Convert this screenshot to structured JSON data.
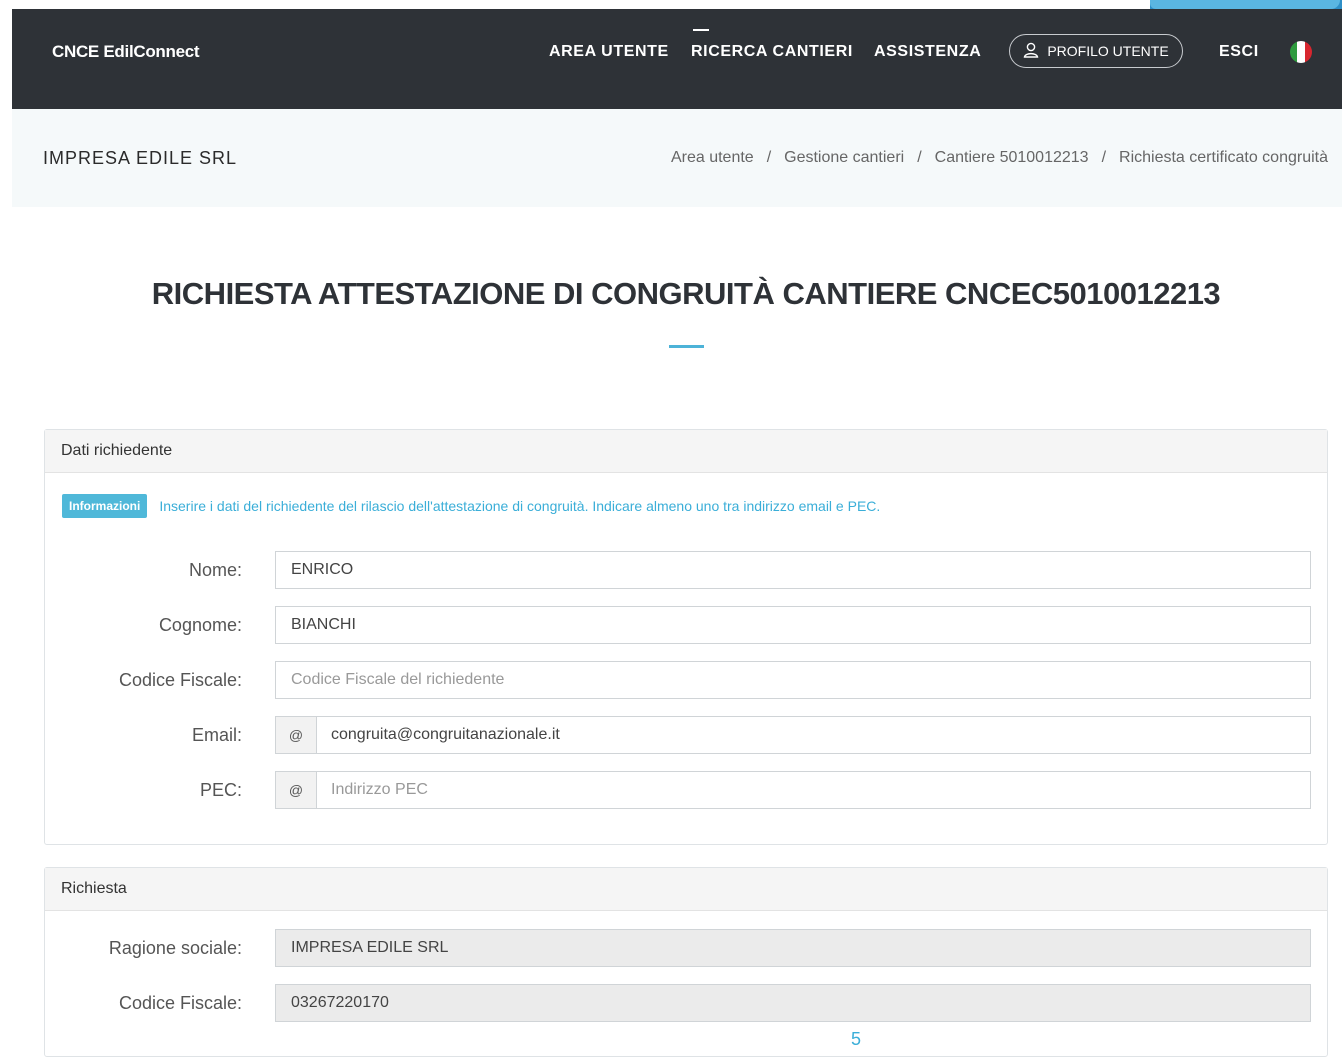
{
  "header": {
    "brand": "CNCE EdilConnect",
    "nav": {
      "area_utente": "AREA UTENTE",
      "ricerca_cantieri": "RICERCA CANTIERI",
      "assistenza": "ASSISTENZA",
      "profilo": "PROFILO UTENTE",
      "esci": "ESCI"
    },
    "colors": {
      "background": "#2e3237",
      "accent": "#4db3d8"
    }
  },
  "breadcrumb_bar": {
    "company": "IMPRESA EDILE SRL",
    "items": [
      "Area utente",
      "Gestione cantieri",
      "Cantiere 5010012213",
      "Richiesta certificato congruità"
    ],
    "separator": "/"
  },
  "page": {
    "title": "RICHIESTA ATTESTAZIONE DI CONGRUITÀ CANTIERE CNCEC5010012213"
  },
  "richiedente": {
    "heading": "Dati richiedente",
    "info_badge": "Informazioni",
    "info_text": "Inserire i dati del richiedente del rilascio dell'attestazione di congruità. Indicare almeno uno tra indirizzo email e PEC.",
    "fields": {
      "nome": {
        "label": "Nome:",
        "value": "ENRICO"
      },
      "cognome": {
        "label": "Cognome:",
        "value": "BIANCHI"
      },
      "codice_fiscale": {
        "label": "Codice Fiscale:",
        "value": "",
        "placeholder": "Codice Fiscale del richiedente"
      },
      "email": {
        "label": "Email:",
        "addon": "@",
        "value": "congruita@congruitanazionale.it"
      },
      "pec": {
        "label": "PEC:",
        "addon": "@",
        "value": "",
        "placeholder": "Indirizzo PEC"
      }
    }
  },
  "richiesta": {
    "heading": "Richiesta",
    "fields": {
      "ragione_sociale": {
        "label": "Ragione sociale:",
        "value": "IMPRESA EDILE SRL"
      },
      "codice_fiscale": {
        "label": "Codice Fiscale:",
        "value": "03267220170"
      }
    }
  },
  "page_number": "5",
  "icons": {
    "profile": "user-icon",
    "language": "italian-flag-icon"
  }
}
